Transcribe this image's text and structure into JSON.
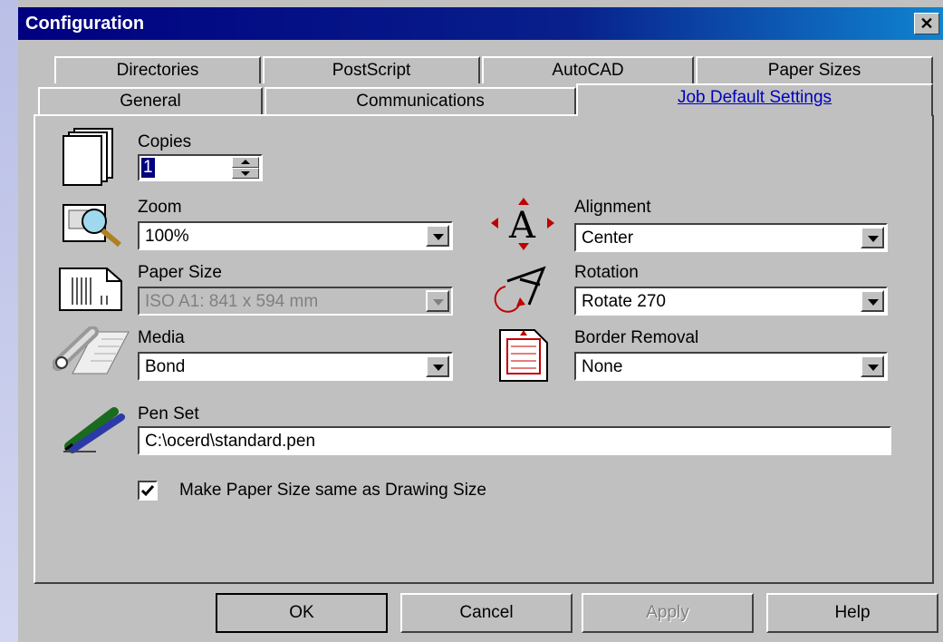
{
  "window": {
    "title": "Configuration",
    "close_glyph": "✕"
  },
  "tabs_row_back": [
    "Directories",
    "PostScript",
    "AutoCAD",
    "Paper Sizes"
  ],
  "tabs_row_front": [
    "General",
    "Communications",
    "Job Default Settings"
  ],
  "active_tab": "Job Default Settings",
  "copies": {
    "label": "Copies",
    "value": "1"
  },
  "zoom": {
    "label": "Zoom",
    "value": "100%"
  },
  "alignment": {
    "label": "Alignment",
    "value": "Center"
  },
  "paper_size": {
    "label": "Paper Size",
    "value": "ISO A1: 841 x 594 mm",
    "disabled": true
  },
  "rotation": {
    "label": "Rotation",
    "value": "Rotate 270"
  },
  "media": {
    "label": "Media",
    "value": "Bond"
  },
  "border_removal": {
    "label": "Border Removal",
    "value": "None"
  },
  "pen_set": {
    "label": "Pen Set",
    "value": "C:\\ocerd\\standard.pen"
  },
  "checkbox": {
    "label": "Make Paper Size same as Drawing Size",
    "checked": true
  },
  "buttons": {
    "ok": "OK",
    "cancel": "Cancel",
    "apply": "Apply",
    "help": "Help"
  },
  "icons": [
    "copies-icon",
    "zoom-magnifier-icon",
    "alignment-icon",
    "paper-size-icon",
    "rotation-icon",
    "media-roll-icon",
    "border-removal-icon",
    "pen-set-icon"
  ],
  "colors": {
    "titlebar": "#000080",
    "face": "#c0c0c0",
    "active_tab_text": "#0000c0"
  }
}
